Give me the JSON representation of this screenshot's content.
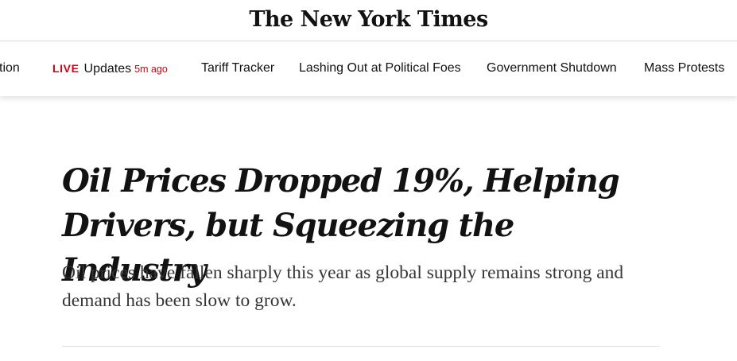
{
  "masthead": {
    "logo_text": "The New York Times"
  },
  "nav": {
    "items": [
      {
        "label": "tion"
      },
      {
        "live": "LIVE",
        "label": "Updates",
        "time": "5m ago"
      },
      {
        "label": "Tariff Tracker"
      },
      {
        "label": "Lashing Out at Political Foes"
      },
      {
        "label": "Government Shutdown"
      },
      {
        "label": "Mass Protests"
      }
    ],
    "live_color": "#d0021b"
  },
  "article": {
    "headline": "Oil Prices Dropped 19%, Helping Drivers, but Squeezing the Industry",
    "summary": "Oil prices have fallen sharply this year as global supply remains strong and demand has been slow to grow."
  }
}
